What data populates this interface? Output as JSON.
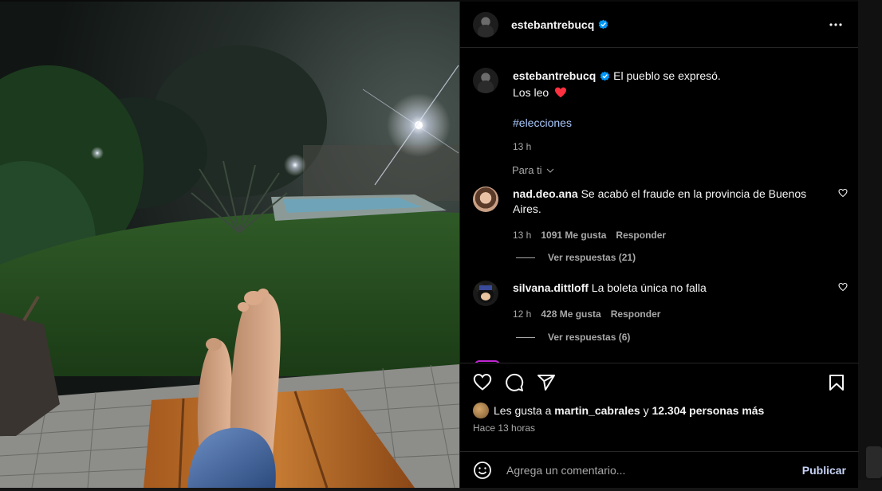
{
  "post": {
    "author": "estebantrebucq",
    "caption_line1": "El pueblo se expresó.",
    "caption_line2": "Los leo",
    "hashtag": "#elecciones",
    "caption_time": "13 h",
    "sort_label": "Para ti",
    "likes_prefix": "Les gusta a",
    "likes_user": "martin_cabrales",
    "likes_conj": "y",
    "likes_count": "12.304 personas más",
    "posted_ago": "Hace 13 horas"
  },
  "comments": [
    {
      "user": "nad.deo.ana",
      "text": "Se acabó el fraude en la provincia de Buenos Aires.",
      "time": "13 h",
      "likes": "1091 Me gusta",
      "reply_label": "Responder",
      "view_replies": "Ver respuestas (21)"
    },
    {
      "user": "silvana.dittloff",
      "text": "La boleta única no falla",
      "time": "12 h",
      "likes": "428 Me gusta",
      "reply_label": "Responder",
      "view_replies": "Ver respuestas (6)"
    }
  ],
  "composer": {
    "placeholder": "Agrega un comentario...",
    "publish_label": "Publicar"
  },
  "icons": {
    "verified": "verified-badge-icon",
    "more": "more-options-icon",
    "like": "heart-icon",
    "comment": "comment-icon",
    "share": "share-icon",
    "save": "bookmark-icon",
    "emoji": "emoji-icon",
    "chevron": "chevron-down-icon"
  },
  "colors": {
    "panel_bg": "#000000",
    "verified": "#0095f6",
    "caption_heart": "#ff3040",
    "hashtag": "#a8c7fa",
    "muted": "#a8a8a8"
  }
}
